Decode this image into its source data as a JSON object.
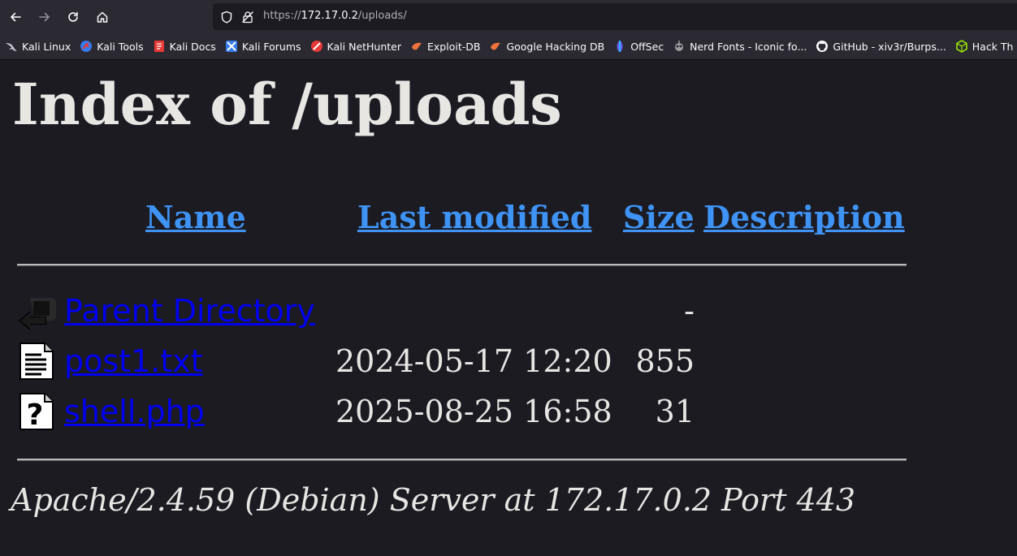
{
  "browser": {
    "url_prefix": "https://",
    "url_host": "172.17.0.2",
    "url_path": "/uploads/"
  },
  "bookmarks": [
    {
      "label": "Kali Linux",
      "icon": "kali-dragon-icon"
    },
    {
      "label": "Kali Tools",
      "icon": "kali-tools-icon"
    },
    {
      "label": "Kali Docs",
      "icon": "kali-docs-icon"
    },
    {
      "label": "Kali Forums",
      "icon": "kali-forums-icon"
    },
    {
      "label": "Kali NetHunter",
      "icon": "kali-nethunter-icon"
    },
    {
      "label": "Exploit-DB",
      "icon": "exploit-db-icon"
    },
    {
      "label": "Google Hacking DB",
      "icon": "ghdb-icon"
    },
    {
      "label": "OffSec",
      "icon": "offsec-icon"
    },
    {
      "label": "Nerd Fonts - Iconic fo...",
      "icon": "nerd-fonts-icon"
    },
    {
      "label": "GitHub - xiv3r/Burps...",
      "icon": "github-icon"
    },
    {
      "label": "Hack Th",
      "icon": "hackthebox-icon"
    }
  ],
  "page": {
    "title": "Index of /uploads",
    "columns": {
      "name": "Name",
      "last_modified": "Last modified",
      "size": "Size",
      "description": "Description"
    },
    "rows": [
      {
        "name": "Parent Directory",
        "modified": "",
        "size": "-",
        "icon": "back-arrow-icon"
      },
      {
        "name": "post1.txt",
        "modified": "2024-05-17 12:20",
        "size": "855",
        "icon": "text-file-icon"
      },
      {
        "name": "shell.php",
        "modified": "2025-08-25 16:58",
        "size": "31",
        "icon": "unknown-file-icon"
      }
    ],
    "footer": "Apache/2.4.59 (Debian) Server at 172.17.0.2 Port 443"
  },
  "colors": {
    "background": "#1c1b22",
    "link": "#3e93f5",
    "text": "#e8e6e3",
    "chrome": "#2b2a33"
  }
}
